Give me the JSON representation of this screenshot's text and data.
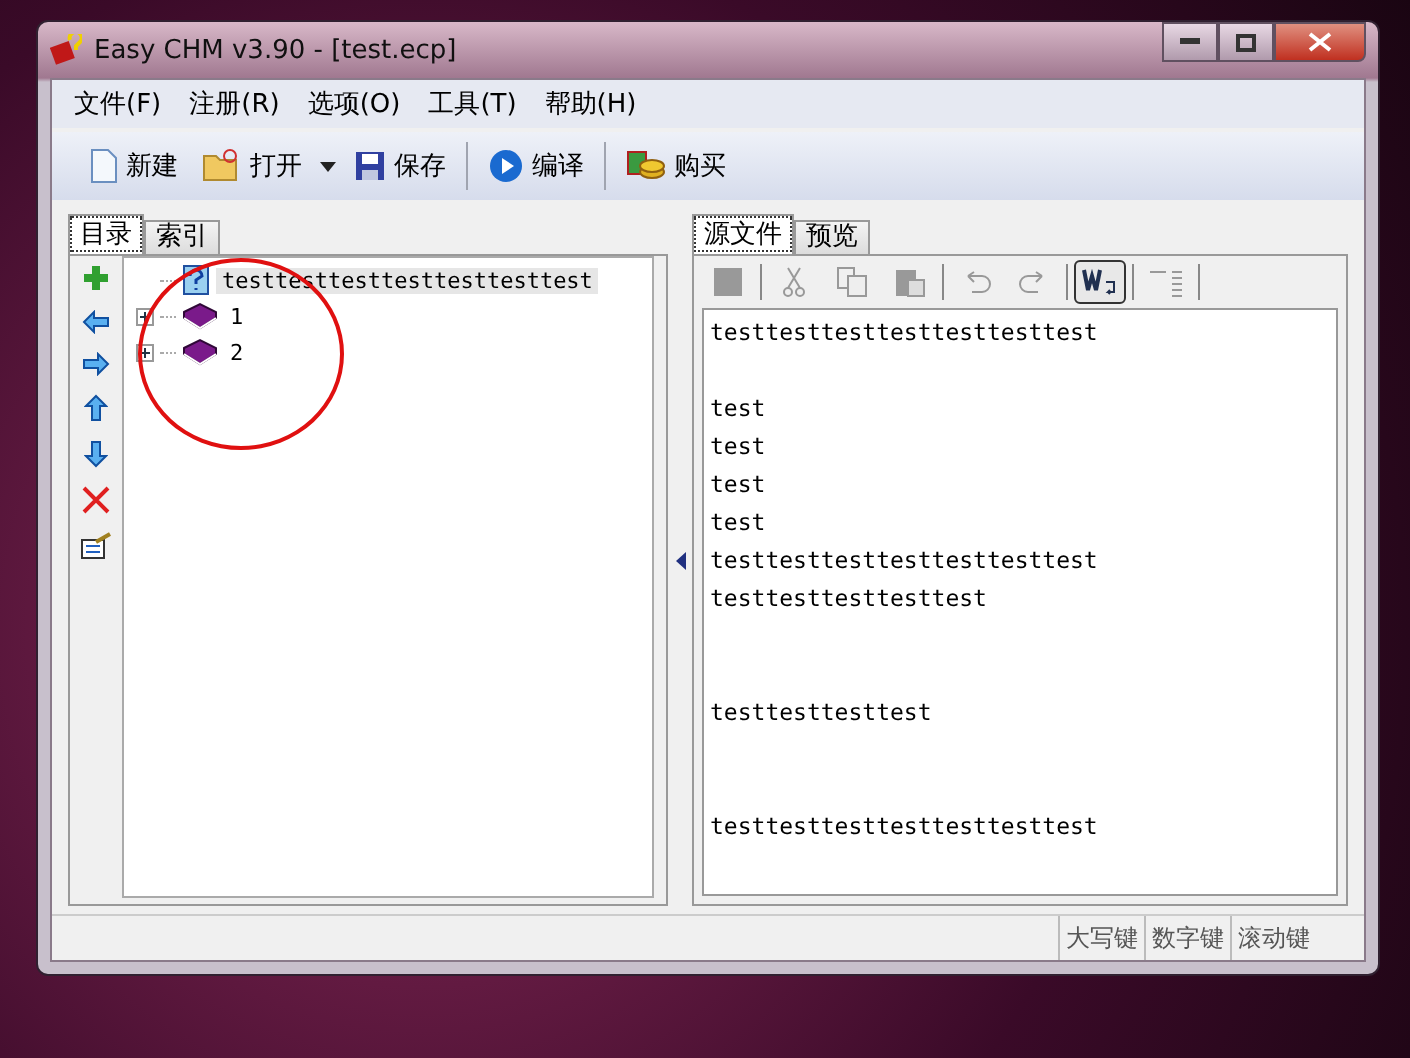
{
  "window": {
    "title": "Easy CHM v3.90 - [test.ecp]"
  },
  "menu": [
    "文件(F)",
    "注册(R)",
    "选项(O)",
    "工具(T)",
    "帮助(H)"
  ],
  "toolbar": [
    {
      "kind": "new",
      "label": "新建"
    },
    {
      "kind": "open",
      "label": "打开"
    },
    {
      "kind": "save",
      "label": "保存"
    },
    {
      "kind": "compile",
      "label": "编译"
    },
    {
      "kind": "buy",
      "label": "购买"
    }
  ],
  "left_tabs": [
    {
      "label": "目录",
      "selected": true
    },
    {
      "label": "索引",
      "selected": false
    }
  ],
  "tree": [
    {
      "kind": "page",
      "label": "testtesttesttesttesttesttest",
      "selected": true
    },
    {
      "kind": "book",
      "label": "1",
      "selected": false,
      "expanded": false
    },
    {
      "kind": "book",
      "label": "2",
      "selected": false,
      "expanded": false
    }
  ],
  "right_tabs": [
    {
      "label": "源文件",
      "selected": true
    },
    {
      "label": "预览",
      "selected": false
    }
  ],
  "editor_tools": [
    {
      "kind": "stop",
      "disabled": true,
      "pressed": false
    },
    {
      "kind": "cut",
      "disabled": true,
      "pressed": false
    },
    {
      "kind": "copy",
      "disabled": true,
      "pressed": false
    },
    {
      "kind": "paste",
      "disabled": true,
      "pressed": false
    },
    {
      "kind": "undo",
      "disabled": true,
      "pressed": false
    },
    {
      "kind": "redo",
      "disabled": true,
      "pressed": false
    },
    {
      "kind": "wrap",
      "disabled": false,
      "pressed": true
    },
    {
      "kind": "ruler",
      "disabled": true,
      "pressed": false
    }
  ],
  "editor": {
    "content": "testtesttesttesttesttesttest\n\ntest\ntest\ntest\ntest\ntesttesttesttesttesttesttest\ntesttesttesttesttest\n\n\ntesttesttesttest\n\n\ntesttesttesttesttesttesttest"
  },
  "status_bar": [
    "大写键",
    "数字键",
    "滚动键"
  ]
}
